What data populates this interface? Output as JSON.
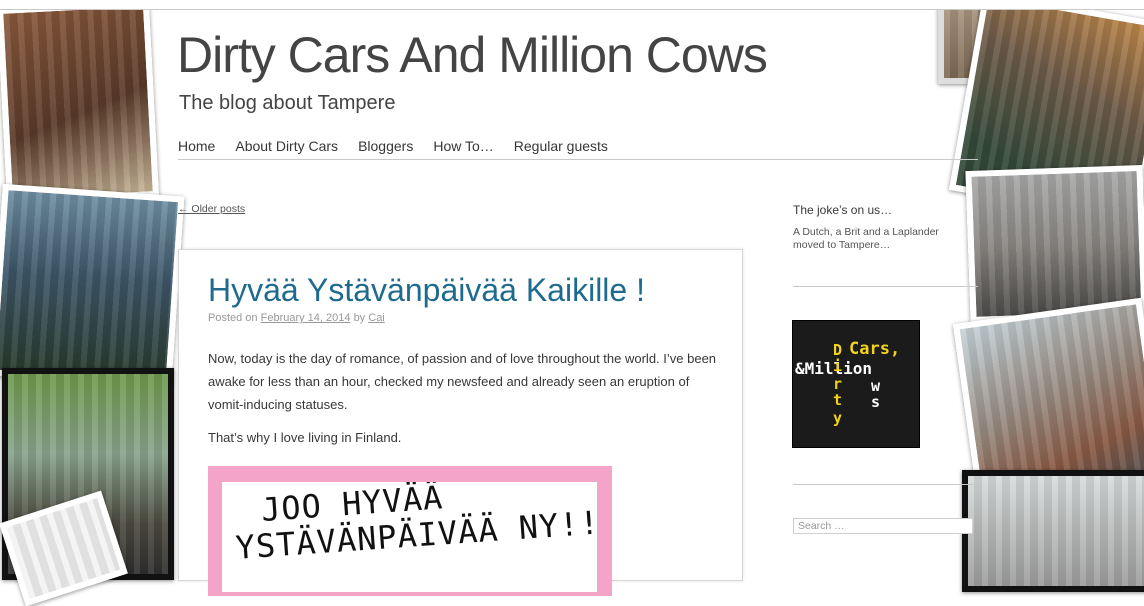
{
  "site": {
    "title": "Dirty Cars And Million Cows",
    "description": "The blog about Tampere"
  },
  "nav": {
    "items": [
      "Home",
      "About Dirty Cars",
      "Bloggers",
      "How To…",
      "Regular guests"
    ]
  },
  "older_posts_label": "← Older posts",
  "post": {
    "title": "Hyvää Ystävänpäivää Kaikille !",
    "meta_prefix": "Posted on",
    "date": "February 14, 2014",
    "by": "by",
    "author": "Cai",
    "paragraphs": [
      "Now, today is the day of romance, of passion and of love throughout the world. I’ve been awake for less than an hour, checked my newsfeed and already seen an eruption of vomit-inducing statuses.",
      "That’s why I love living in Finland."
    ],
    "image_text_line1": "JOO HYVÄÄ",
    "image_text_line2": "YSTÄVÄNPÄIVÄÄ NY!!"
  },
  "sidebar": {
    "widget_title": "The joke’s on us…",
    "widget_text": "A Dutch, a Brit and a Laplander moved to Tampere…",
    "logo": {
      "cars": "Cars,",
      "amp_million": "&Million",
      "ows_w": "w",
      "ows_s": "s",
      "dirty_d": "D",
      "dirty_i": "i",
      "dirty_r": "r",
      "dirty_t": "t",
      "dirty_y": "y"
    },
    "search_placeholder": "Search …"
  },
  "colors": {
    "title_link": "#1f6b8f",
    "text": "#373737",
    "pink_frame": "#f4a4c8",
    "logo_yellow": "#f2d21b"
  }
}
